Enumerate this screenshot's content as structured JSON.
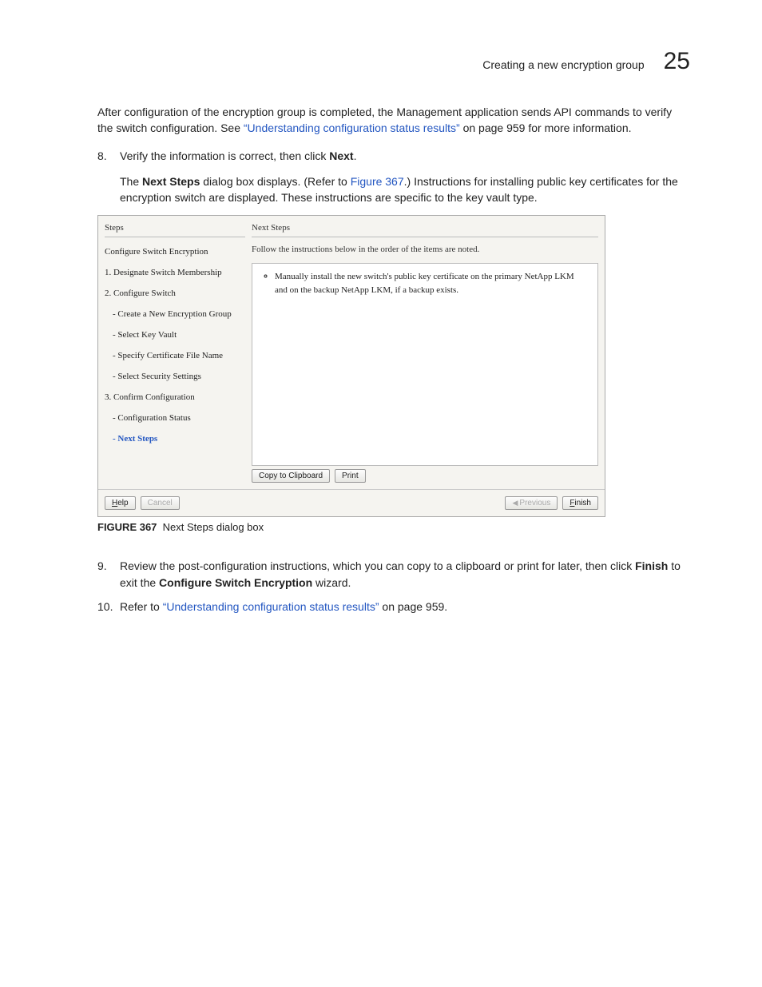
{
  "header": {
    "title": "Creating a new encryption group",
    "chapter": "25"
  },
  "intro": {
    "p1a": "After configuration of the encryption group is completed, the Management application sends API commands to verify the switch configuration. See ",
    "link1": "“Understanding configuration status results”",
    "p1b": " on page 959 for more information."
  },
  "steps": {
    "s8": {
      "num": "8.",
      "line1a": "Verify the information is correct, then click ",
      "line1b_bold": "Next",
      "line1c": ".",
      "p2a": "The ",
      "p2b_bold": "Next Steps",
      "p2c": " dialog box displays. (Refer to ",
      "p2link": "Figure 367",
      "p2d": ".) Instructions for installing public key certificates for the encryption switch are displayed. These instructions are specific to the key vault type."
    },
    "s9": {
      "num": "9.",
      "a": "Review the post-configuration instructions, which you can copy to a clipboard or print for later, then click ",
      "b_bold": "Finish",
      "c": " to exit the ",
      "d_bold": "Configure Switch Encryption",
      "e": " wizard."
    },
    "s10": {
      "num": "10.",
      "a": "Refer to ",
      "link": "“Understanding configuration status results”",
      "b": " on page 959."
    }
  },
  "dialog": {
    "stepsLabel": "Steps",
    "list": [
      {
        "text": "Configure Switch Encryption",
        "sub": false
      },
      {
        "text": "1. Designate Switch Membership",
        "sub": false
      },
      {
        "text": "2. Configure Switch",
        "sub": false
      },
      {
        "text": "- Create a New Encryption Group",
        "sub": true
      },
      {
        "text": "- Select Key Vault",
        "sub": true
      },
      {
        "text": "- Specify Certificate File Name",
        "sub": true
      },
      {
        "text": "- Select Security Settings",
        "sub": true
      },
      {
        "text": "3. Confirm Configuration",
        "sub": false
      },
      {
        "text": "- Configuration Status",
        "sub": true
      },
      {
        "text": "- Next Steps",
        "sub": true,
        "current": true
      }
    ],
    "rightLabel": "Next Steps",
    "instruction": "Follow the instructions below in the order of the items are noted.",
    "bullet": "Manually install the new switch's public key certificate on the primary NetApp LKM and on the backup NetApp LKM, if a backup exists.",
    "copy": "Copy to Clipboard",
    "print": "Print",
    "help": "Help",
    "cancel": "Cancel",
    "previous": "Previous",
    "finish": "Finish"
  },
  "figure": {
    "label": "FIGURE 367",
    "caption": "Next Steps dialog box"
  }
}
